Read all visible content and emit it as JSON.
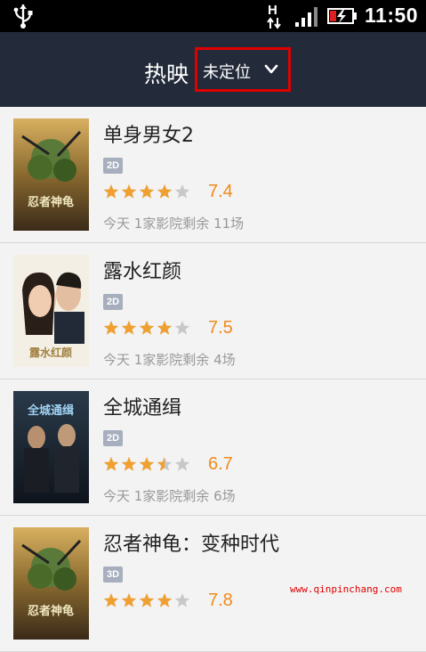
{
  "status_bar": {
    "time": "11:50",
    "network": "H",
    "icons": [
      "usb-icon",
      "network-h-icon",
      "signal-icon",
      "battery-charging-icon"
    ]
  },
  "header": {
    "title": "热映",
    "location": "未定位",
    "location_icon": "chevron-down-icon",
    "highlight_color": "#e00000"
  },
  "movies": [
    {
      "title": "单身男女2",
      "format": "2D",
      "stars": 4,
      "rating": "7.4",
      "showtimes": "今天 1家影院剩余 11场",
      "poster_text": "忍者神龟"
    },
    {
      "title": "露水红颜",
      "format": "2D",
      "stars": 4,
      "rating": "7.5",
      "showtimes": "今天 1家影院剩余 4场",
      "poster_text": "露水红颜"
    },
    {
      "title": "全城通缉",
      "format": "2D",
      "stars": 3.5,
      "rating": "6.7",
      "showtimes": "今天 1家影院剩余 6场",
      "poster_text": "全城通缉"
    },
    {
      "title": "忍者神龟：变种时代",
      "format": "3D",
      "stars": 4,
      "rating": "7.8",
      "showtimes": "",
      "poster_text": "忍者神龟"
    }
  ],
  "colors": {
    "header_bg": "#232b3a",
    "rating": "#f08a1c",
    "star_filled": "#f0a030",
    "star_empty": "#c8c8c8",
    "badge": "#a7aebd"
  },
  "watermark": "www.qinpinchang.com"
}
